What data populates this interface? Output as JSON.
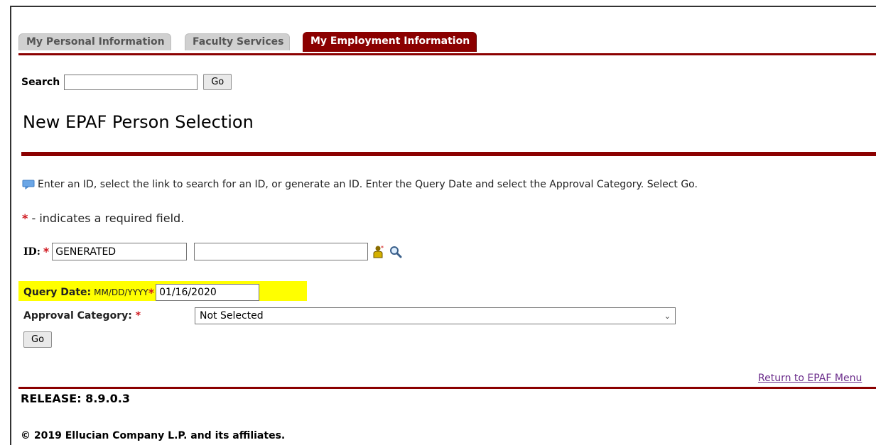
{
  "tabs": [
    {
      "label": "My Personal Information"
    },
    {
      "label": "Faculty Services"
    },
    {
      "label": "My Employment Information",
      "active": true
    }
  ],
  "search": {
    "label": "Search",
    "value": "",
    "go_label": "Go"
  },
  "page": {
    "title": "New EPAF Person Selection"
  },
  "info_text": "Enter an ID, select the link to search for an ID, or generate an ID. Enter the Query Date and select the Approval Category. Select Go.",
  "required_note": {
    "star": "*",
    "text": " - indicates a required field."
  },
  "id_field": {
    "label": "ID:",
    "star": "*",
    "value": "GENERATED",
    "name_value": ""
  },
  "query_date": {
    "label": "Query Date:",
    "format": "MM/DD/YYYY",
    "star": "*",
    "value": "01/16/2020"
  },
  "approval_category": {
    "label": "Approval Category:",
    "star": "*",
    "selected": "Not Selected"
  },
  "go_label": "Go",
  "return_link": "Return to EPAF Menu",
  "release": "RELEASE: 8.9.0.3",
  "copyright": "© 2019 Ellucian Company L.P. and its affiliates.",
  "colors": {
    "accent": "#8b0000",
    "required": "#d0181f",
    "highlight": "#ffff00",
    "link": "#6a2b8a"
  },
  "icons": [
    "info-icon",
    "generate-id-icon",
    "search-icon",
    "chevron-down-icon"
  ]
}
